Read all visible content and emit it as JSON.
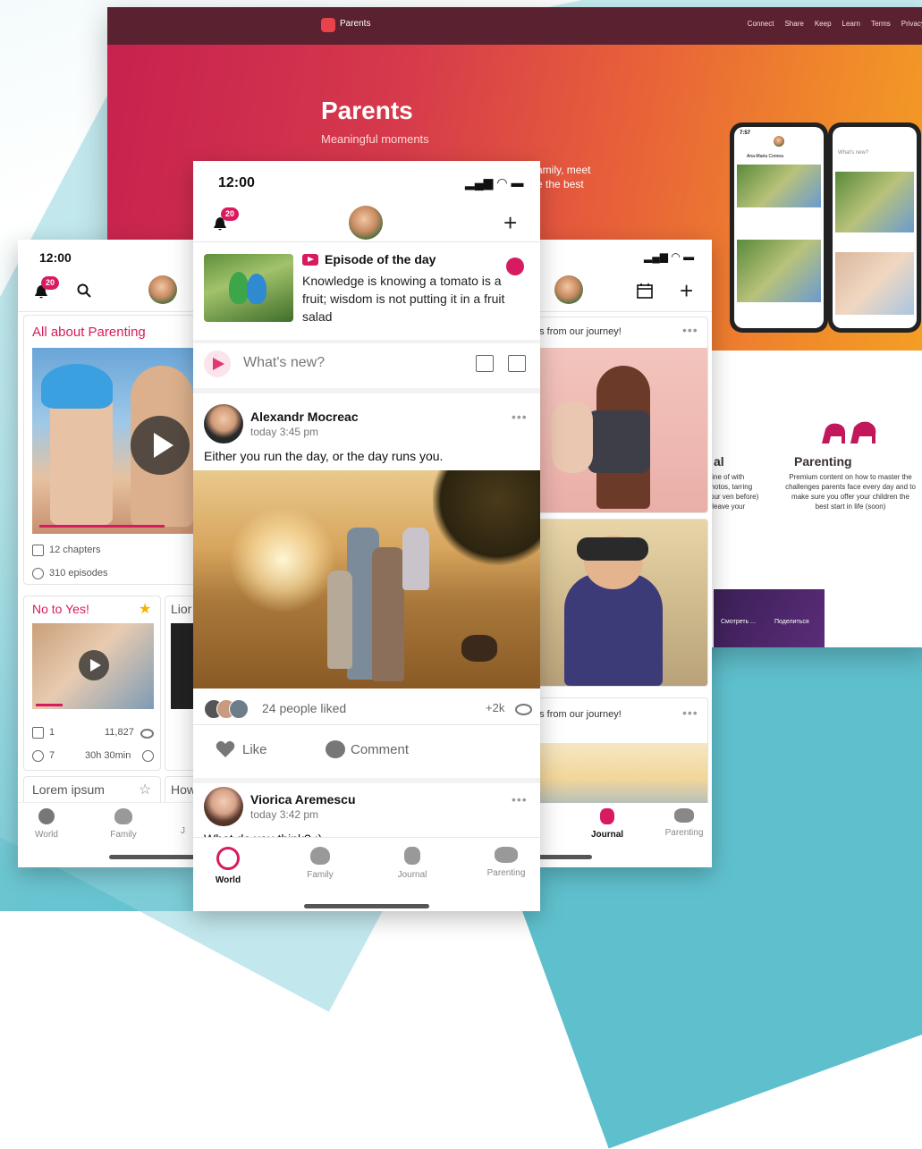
{
  "website": {
    "brand": "Parents",
    "nav_links": [
      "Connect",
      "Share",
      "Keep",
      "Learn",
      "Terms",
      "Privacy"
    ],
    "hero_title": "Parents",
    "hero_subtitle": "Meaningful moments",
    "hero_text_line1": "amily, meet",
    "hero_text_line2": "e the best",
    "feature_parenting_title": "Parenting",
    "feature_parenting_text": "Premium content on how to master the challenges parents face every day and to make sure you offer your children the best start in life (soon)",
    "feature_left_title": "al",
    "feature_left_text": "eline of with photos, tarring your ven before) y leave your",
    "video_watch": "Смотреть ...",
    "video_share": "Поделиться",
    "mini_phone_whats_new": "What's new?",
    "mini_phone_user": "Ana-Maria Cornea",
    "mini_phone_time": "7:57"
  },
  "center_phone": {
    "time": "12:00",
    "notif_count": "20",
    "episode_title": "Episode of the day",
    "episode_text": "Knowledge is knowing a tomato is a fruit; wisdom is not putting it in a fruit salad",
    "compose_placeholder": "What's new?",
    "post1": {
      "author": "Alexandr Mocreac",
      "time": "today 3:45 pm",
      "text": "Either you run the day, or the day runs you.",
      "likes": "24 people liked",
      "views": "+2k",
      "like_label": "Like",
      "comment_label": "Comment"
    },
    "post2": {
      "author": "Viorica Aremescu",
      "time": "today 3:42 pm",
      "text": "What do you think? :)"
    },
    "tabs": [
      "World",
      "Family",
      "Journal",
      "Parenting"
    ],
    "active_tab": "World"
  },
  "left_phone": {
    "time": "12:00",
    "notif_count": "20",
    "section_title": "All about Parenting",
    "chapters": "12 chapters",
    "episodes": "310 episodes",
    "card1_title": "No to Yes!",
    "card1_chapters": "1",
    "card1_views": "11,827",
    "card1_episodes": "7",
    "card1_duration": "30h 30min",
    "card2_title": "Lior",
    "card3_title": "Lorem ipsum",
    "card4_title": "How",
    "tabs": [
      "World",
      "Family",
      "J"
    ]
  },
  "right_phone": {
    "post1_title": "os from our journey!",
    "post2_title": "os from our journey!",
    "tabs": [
      "Journal",
      "Parenting"
    ],
    "active_tab": "Journal"
  }
}
